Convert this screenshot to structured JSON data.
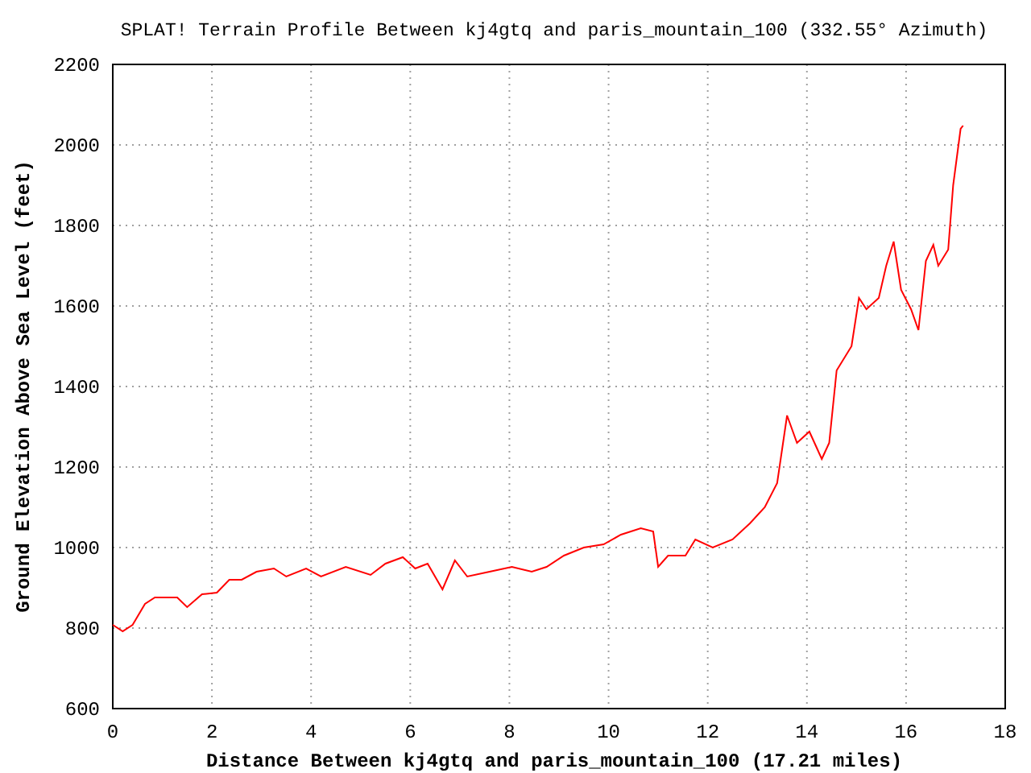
{
  "chart_data": {
    "type": "line",
    "title": "SPLAT! Terrain Profile Between kj4gtq and paris_mountain_100 (332.55° Azimuth)",
    "xlabel": "Distance Between kj4gtq and paris_mountain_100 (17.21 miles)",
    "ylabel": "Ground Elevation Above Sea Level (feet)",
    "grid": true,
    "xlim": [
      0,
      18
    ],
    "ylim": [
      600,
      2200
    ],
    "xticks": [
      0,
      2,
      4,
      6,
      8,
      10,
      12,
      14,
      16,
      18
    ],
    "yticks": [
      600,
      800,
      1000,
      1200,
      1400,
      1600,
      1800,
      2000,
      2200
    ],
    "x": [
      0,
      0.2,
      0.4,
      0.65,
      0.85,
      1.3,
      1.5,
      1.8,
      2.1,
      2.35,
      2.6,
      2.9,
      3.25,
      3.5,
      3.9,
      4.2,
      4.7,
      5.2,
      5.5,
      5.85,
      6.1,
      6.35,
      6.65,
      6.9,
      7.15,
      7.6,
      8.05,
      8.45,
      8.75,
      9.1,
      9.5,
      9.9,
      10.25,
      10.65,
      10.9,
      11.0,
      11.2,
      11.55,
      11.75,
      12.1,
      12.5,
      12.85,
      13.15,
      13.4,
      13.6,
      13.8,
      14.05,
      14.3,
      14.45,
      14.6,
      14.9,
      15.05,
      15.2,
      15.45,
      15.6,
      15.75,
      15.9,
      16.1,
      16.25,
      16.4,
      16.55,
      16.65,
      16.85,
      16.95,
      17.1,
      17.15
    ],
    "series": [
      {
        "color": "#ff0000",
        "values": [
          808,
          792,
          808,
          860,
          876,
          876,
          852,
          884,
          888,
          920,
          920,
          940,
          948,
          928,
          948,
          928,
          952,
          932,
          960,
          976,
          948,
          960,
          896,
          968,
          928,
          940,
          952,
          940,
          952,
          980,
          1000,
          1008,
          1032,
          1048,
          1040,
          952,
          980,
          980,
          1020,
          1000,
          1020,
          1060,
          1100,
          1160,
          1328,
          1260,
          1288,
          1220,
          1260,
          1440,
          1500,
          1620,
          1592,
          1620,
          1700,
          1760,
          1640,
          1592,
          1540,
          1712,
          1752,
          1700,
          1740,
          1900,
          2040,
          2048
        ]
      }
    ]
  }
}
